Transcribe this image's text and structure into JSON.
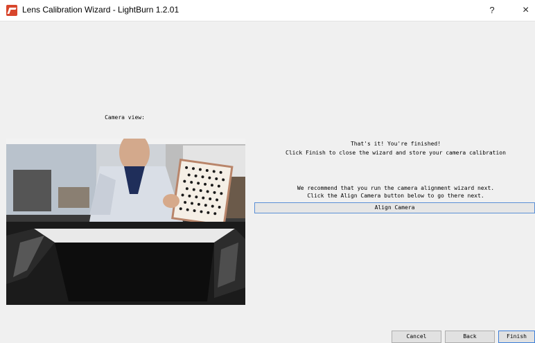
{
  "window": {
    "title": "Lens Calibration Wizard - LightBurn 1.2.01",
    "help_label": "?",
    "close_label": "×",
    "icon": "lightburn-app-icon"
  },
  "camera": {
    "label": "Camera view:"
  },
  "messages": {
    "line1": "That's it!  You're finished!",
    "line2": "Click Finish to close the wizard and store your camera calibration",
    "line3": "We recommend that you run the camera alignment wizard next.",
    "line4": "Click the Align Camera button below to go there next."
  },
  "buttons": {
    "align": "Align Camera",
    "cancel": "Cancel",
    "back": "Back",
    "finish": "Finish"
  },
  "colors": {
    "accent": "#3b7dd8",
    "brand": "#d8462c"
  }
}
